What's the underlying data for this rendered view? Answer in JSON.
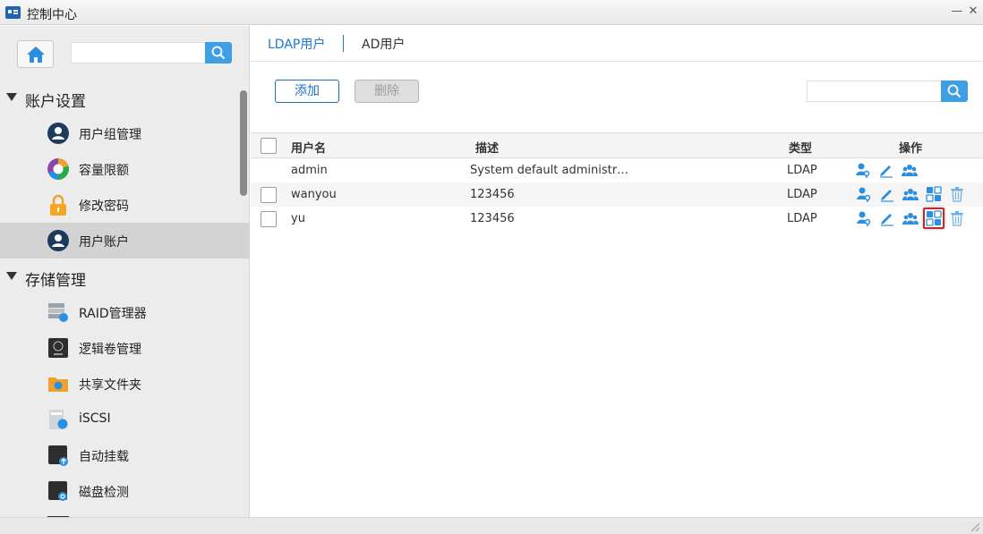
{
  "window": {
    "title": "控制中心",
    "minimize_glyph": "—",
    "close_glyph": "✕"
  },
  "sidebar": {
    "search": {
      "placeholder": ""
    },
    "sections": [
      {
        "label": "账户设置",
        "items": [
          {
            "label": "用户组管理",
            "icon": "user-group-icon"
          },
          {
            "label": "容量限额",
            "icon": "quota-pie-icon"
          },
          {
            "label": "修改密码",
            "icon": "lock-icon"
          },
          {
            "label": "用户账户",
            "icon": "user-account-icon",
            "active": true
          }
        ]
      },
      {
        "label": "存储管理",
        "items": [
          {
            "label": "RAID管理器",
            "icon": "raid-icon"
          },
          {
            "label": "逻辑卷管理",
            "icon": "lvm-icon"
          },
          {
            "label": "共享文件夹",
            "icon": "shared-folder-icon"
          },
          {
            "label": "iSCSI",
            "icon": "iscsi-icon"
          },
          {
            "label": "自动挂载",
            "icon": "auto-mount-icon"
          },
          {
            "label": "磁盘检测",
            "icon": "disk-check-icon"
          }
        ]
      }
    ]
  },
  "main": {
    "tabs": [
      {
        "label": "LDAP用户",
        "active": true
      },
      {
        "label": "AD用户",
        "active": false
      }
    ],
    "toolbar": {
      "add_label": "添加",
      "delete_label": "删除",
      "search_placeholder": ""
    },
    "table": {
      "headers": {
        "username": "用户名",
        "description": "描述",
        "type": "类型",
        "actions": "操作"
      },
      "rows": [
        {
          "username": "admin",
          "description": "System default administr…",
          "type": "LDAP",
          "actions": [
            "key-user-icon",
            "edit-icon",
            "group-icon"
          ],
          "checkbox": false
        },
        {
          "username": "wanyou",
          "description": "123456",
          "type": "LDAP",
          "actions": [
            "key-user-icon",
            "edit-icon",
            "group-icon",
            "app-permission-icon",
            "delete-icon"
          ],
          "checkbox": true
        },
        {
          "username": "yu",
          "description": "123456",
          "type": "LDAP",
          "actions": [
            "key-user-icon",
            "edit-icon",
            "group-icon",
            "app-permission-icon",
            "delete-icon"
          ],
          "checkbox": true,
          "highlighted_action": "app-permission-icon"
        }
      ]
    }
  },
  "colors": {
    "accent": "#1976d2",
    "icon_blue": "#2b8fe0",
    "highlight_border": "#c62828"
  }
}
